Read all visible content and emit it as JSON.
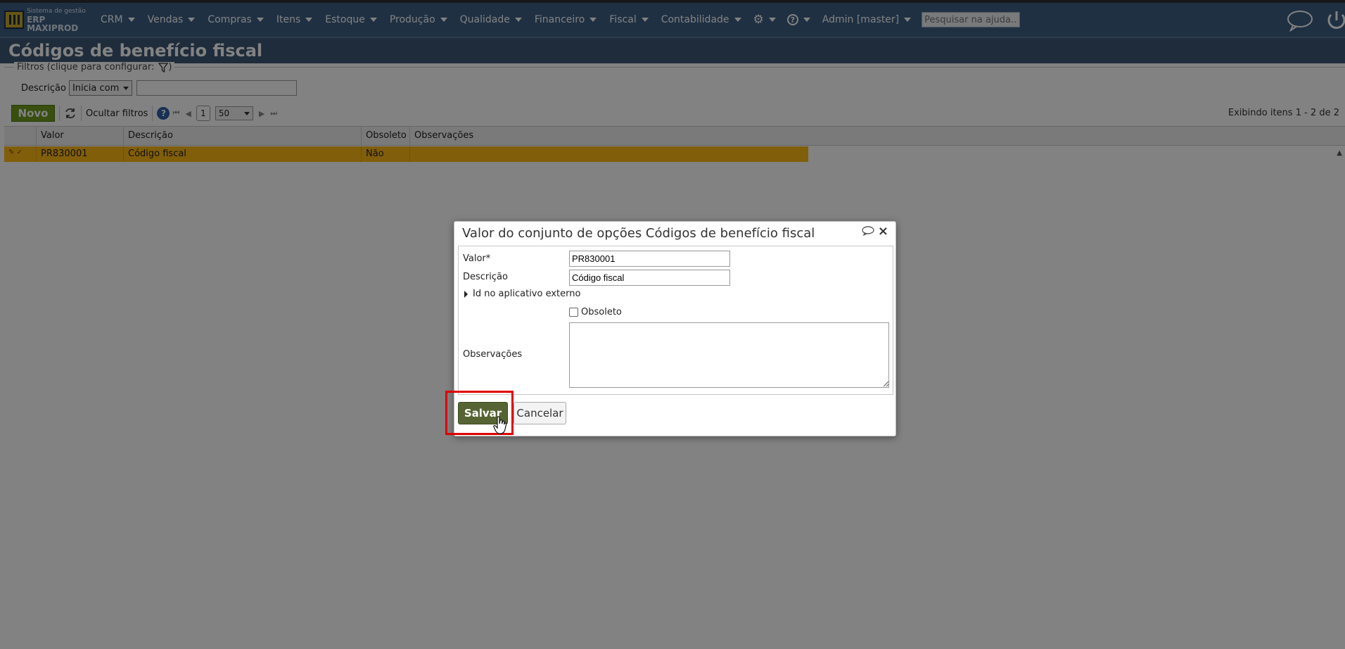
{
  "topnav": {
    "logo_line1": "Sistema de gestão",
    "logo_line2": "ERP MAXIPROD",
    "menu": [
      "CRM",
      "Vendas",
      "Compras",
      "Itens",
      "Estoque",
      "Produção",
      "Qualidade",
      "Financeiro",
      "Fiscal",
      "Contabilidade"
    ],
    "user": "Admin [master]",
    "search_placeholder": "Pesquisar na ajuda...",
    "icons": [
      "gear-icon",
      "help-icon",
      "chat-icon",
      "power-icon"
    ]
  },
  "page": {
    "title": "Códigos de benefício fiscal"
  },
  "filters": {
    "legend": "Filtros (clique para configurar:",
    "legend_end": ")",
    "field_label": "Descrição",
    "operator": "Inicia com",
    "value": ""
  },
  "toolbar": {
    "new_label": "Novo",
    "hide_filters_label": "Ocultar filtros",
    "page": "1",
    "page_size": "50",
    "info": "Exibindo itens 1 - 2 de 2"
  },
  "grid": {
    "columns": [
      "Valor",
      "Descrição",
      "Obsoleto",
      "Observações"
    ],
    "rows": [
      {
        "valor": "PR830001",
        "descricao": "Código fiscal",
        "obsoleto": "Não",
        "observacoes": ""
      }
    ]
  },
  "dialog": {
    "title": "Valor do conjunto de opções Códigos de benefício fiscal",
    "valor_label": "Valor*",
    "valor_value": "PR830001",
    "descricao_label": "Descrição",
    "descricao_value": "Código fiscal",
    "external_id_label": "Id no aplicativo externo",
    "obsoleto_label": "Obsoleto",
    "obsoleto_checked": false,
    "observacoes_label": "Observações",
    "observacoes_value": "",
    "save_label": "Salvar",
    "cancel_label": "Cancelar"
  },
  "colors": {
    "nav_bg": "#3e5f84",
    "title_bg": "#3b5774",
    "new_button": "#6e9c1f",
    "selected_row": "#fdb913",
    "save_button": "#556432",
    "highlight": "#e00000"
  }
}
